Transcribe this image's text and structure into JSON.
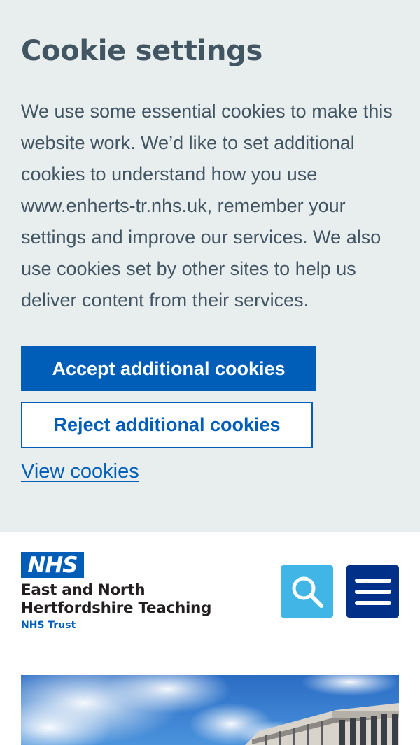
{
  "cookie_banner": {
    "title": "Cookie settings",
    "description": "We use some essential cookies to make this website work. We’d like to set additional cookies to understand how you use www.enherts-tr.nhs.uk, remember your settings and improve our services. We also use cookies set by other sites to help us deliver content from their services.",
    "accept_label": "Accept additional cookies",
    "reject_label": "Reject additional cookies",
    "view_link": "View cookies"
  },
  "header": {
    "logo_text": "NHS",
    "org_line1": "East and North",
    "org_line2": "Hertfordshire Teaching",
    "org_sub": "NHS Trust",
    "search_icon": "search-icon",
    "menu_icon": "hamburger-menu-icon"
  },
  "colors": {
    "banner_bg": "#e8edee",
    "text": "#425563",
    "nhs_blue": "#005eb8",
    "search_bg": "#41b6e6",
    "menu_bg": "#003087"
  }
}
